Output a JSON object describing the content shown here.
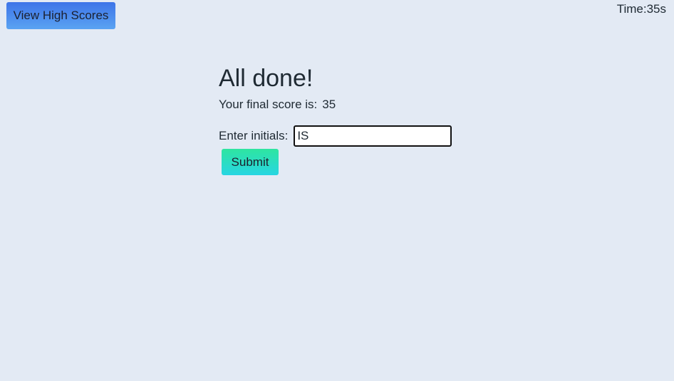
{
  "header": {
    "high_scores_label": "View High Scores",
    "timer_prefix": "Time:",
    "timer_value": "35s"
  },
  "main": {
    "heading": "All done!",
    "score_label": "Your final score is:",
    "score_value": "35",
    "initials_label": "Enter initials:",
    "initials_value": "IS",
    "submit_label": "Submit"
  },
  "colors": {
    "background": "#e3eaf4",
    "high_scores_button_top": "#3d74e8",
    "high_scores_button_bottom": "#5aa3f2",
    "submit_button_top": "#2ee5a0",
    "submit_button_bottom": "#27d6e2"
  }
}
